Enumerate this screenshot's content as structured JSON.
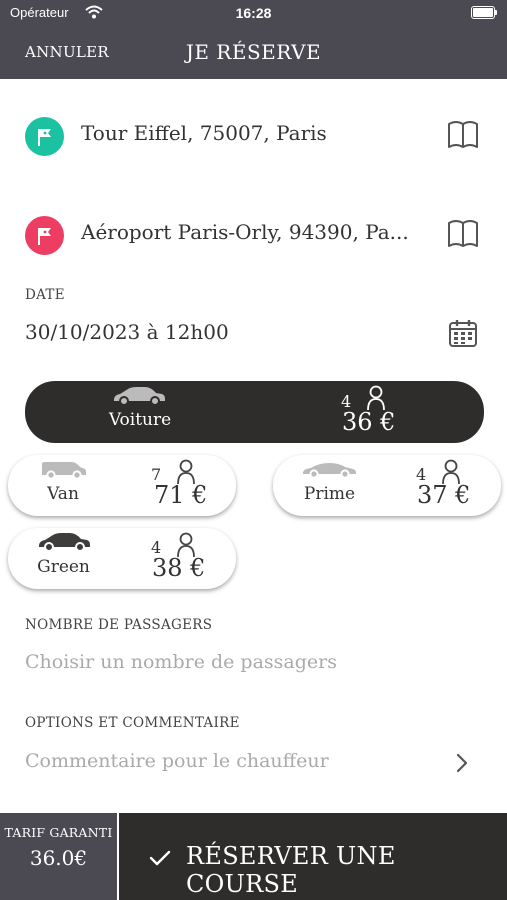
{
  "status_bar": {
    "carrier": "Opérateur",
    "time": "16:28"
  },
  "nav": {
    "cancel_label": "ANNULER",
    "title": "JE RÉSERVE"
  },
  "pickup": {
    "address": "Tour Eiffel, 75007, Paris",
    "color": "#1bc1a1"
  },
  "dropoff": {
    "address": "Aéroport Paris-Orly, 94390, Pa...",
    "color": "#ee3d62"
  },
  "date": {
    "label": "DATE",
    "value": "30/10/2023 à 12h00"
  },
  "vehicles": [
    {
      "name": "Voiture",
      "seats": "4",
      "price": "36 €",
      "selected": true,
      "icon": "car-icon"
    },
    {
      "name": "Van",
      "seats": "7",
      "price": "71 €",
      "selected": false,
      "icon": "van-icon"
    },
    {
      "name": "Prime",
      "seats": "4",
      "price": "37 €",
      "selected": false,
      "icon": "sports-car-icon"
    },
    {
      "name": "Green",
      "seats": "4",
      "price": "38 €",
      "selected": false,
      "icon": "car-icon"
    }
  ],
  "passengers": {
    "label": "NOMBRE DE PASSAGERS",
    "placeholder": "Choisir un nombre de passagers"
  },
  "options": {
    "label": "OPTIONS ET COMMENTAIRE",
    "placeholder": "Commentaire pour le chauffeur"
  },
  "footer": {
    "tarif_label": "TARIF GARANTI",
    "tarif_value": "36.0€",
    "reserve_label": "RÉSERVER UNE COURSE"
  },
  "colors": {
    "header_bg": "#4b4951",
    "dark_button": "#2f2c2c"
  }
}
